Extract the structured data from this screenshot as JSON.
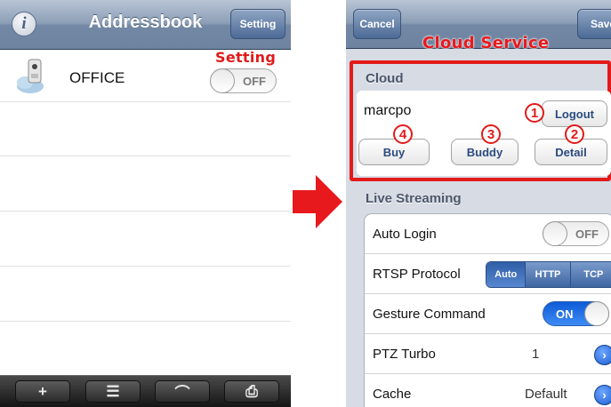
{
  "left_screen": {
    "title": "Addressbook",
    "setting_button": "Setting",
    "setting_annotation": "Setting",
    "device": {
      "name": "OFFICE",
      "toggle": "OFF"
    },
    "toolbar_icons": [
      "add-icon",
      "edit-list-icon",
      "chart-icon",
      "print-icon"
    ],
    "toolbar_glyphs": [
      "+",
      "☰",
      "⌒",
      "⎙"
    ]
  },
  "right_screen": {
    "cancel_button": "Cancel",
    "title_annotation": "Cloud Service",
    "save_button": "Save",
    "cloud": {
      "header": "Cloud",
      "username": "marcpo",
      "logout": "Logout",
      "buy": "Buy",
      "buddy": "Buddy",
      "detail": "Detail",
      "markers": {
        "logout": "1",
        "detail": "2",
        "buddy": "3",
        "buy": "4"
      }
    },
    "live_streaming": {
      "header": "Live Streaming",
      "auto_login": {
        "label": "Auto Login",
        "toggle": "OFF"
      },
      "rtsp": {
        "label": "RTSP Protocol",
        "options": [
          "Auto",
          "HTTP",
          "TCP"
        ],
        "selected": "Auto"
      },
      "gesture": {
        "label": "Gesture Command",
        "toggle": "ON"
      },
      "ptz": {
        "label": "PTZ Turbo",
        "value": "1"
      },
      "cache": {
        "label": "Cache",
        "value": "Default"
      }
    }
  },
  "colors": {
    "annotation_red": "#e21a1a",
    "arrow_red": "#e8191d",
    "nav_blue": "#6d83a0"
  }
}
